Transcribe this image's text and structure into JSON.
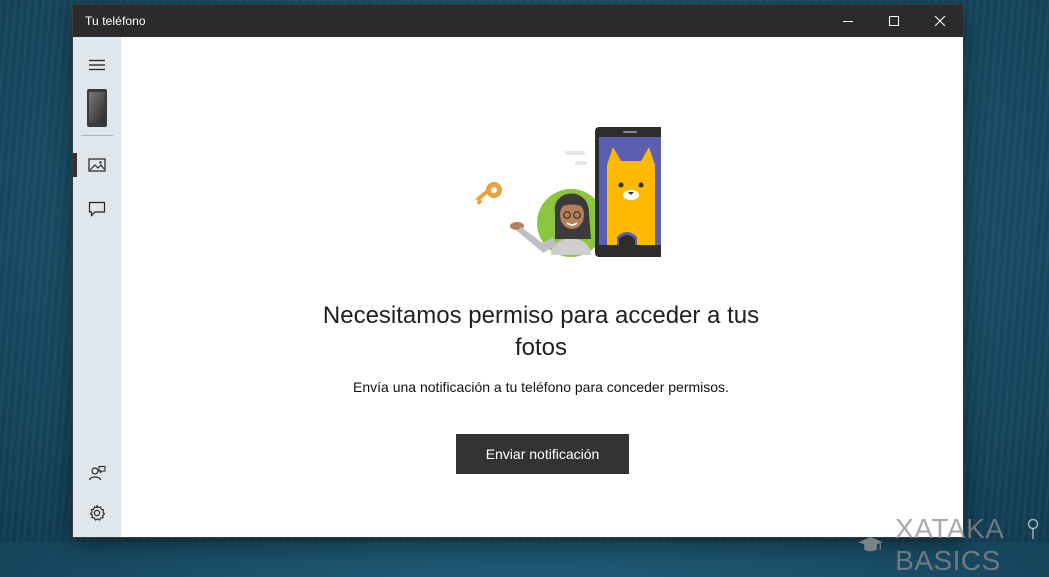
{
  "window": {
    "title": "Tu teléfono",
    "controls": [
      "minimize",
      "maximize",
      "close"
    ]
  },
  "sidebar": {
    "items": [
      {
        "icon": "hamburger-menu-icon"
      },
      {
        "icon": "phone-icon"
      },
      {
        "icon": "photos-icon",
        "active": true
      },
      {
        "icon": "messages-icon"
      },
      {
        "icon": "feedback-icon"
      },
      {
        "icon": "settings-icon"
      }
    ]
  },
  "main": {
    "heading": "Necesitamos permiso para acceder a tus fotos",
    "heading_line1": "Necesitamos permiso para acceder a tus",
    "heading_line2": "fotos",
    "subtext": "Envía una notificación a tu teléfono para conceder permisos.",
    "button_label": "Enviar notificación"
  },
  "watermark": {
    "text": "XATAKA BASICS"
  },
  "colors": {
    "titlebar": "#2b2b2b",
    "sidebar": "#dfe7ec",
    "button": "#333333",
    "phone_screen": "#5a5fb0",
    "cat": "#ffb900",
    "avatar_circle": "#8cc63f",
    "key": "#e8a33d"
  }
}
